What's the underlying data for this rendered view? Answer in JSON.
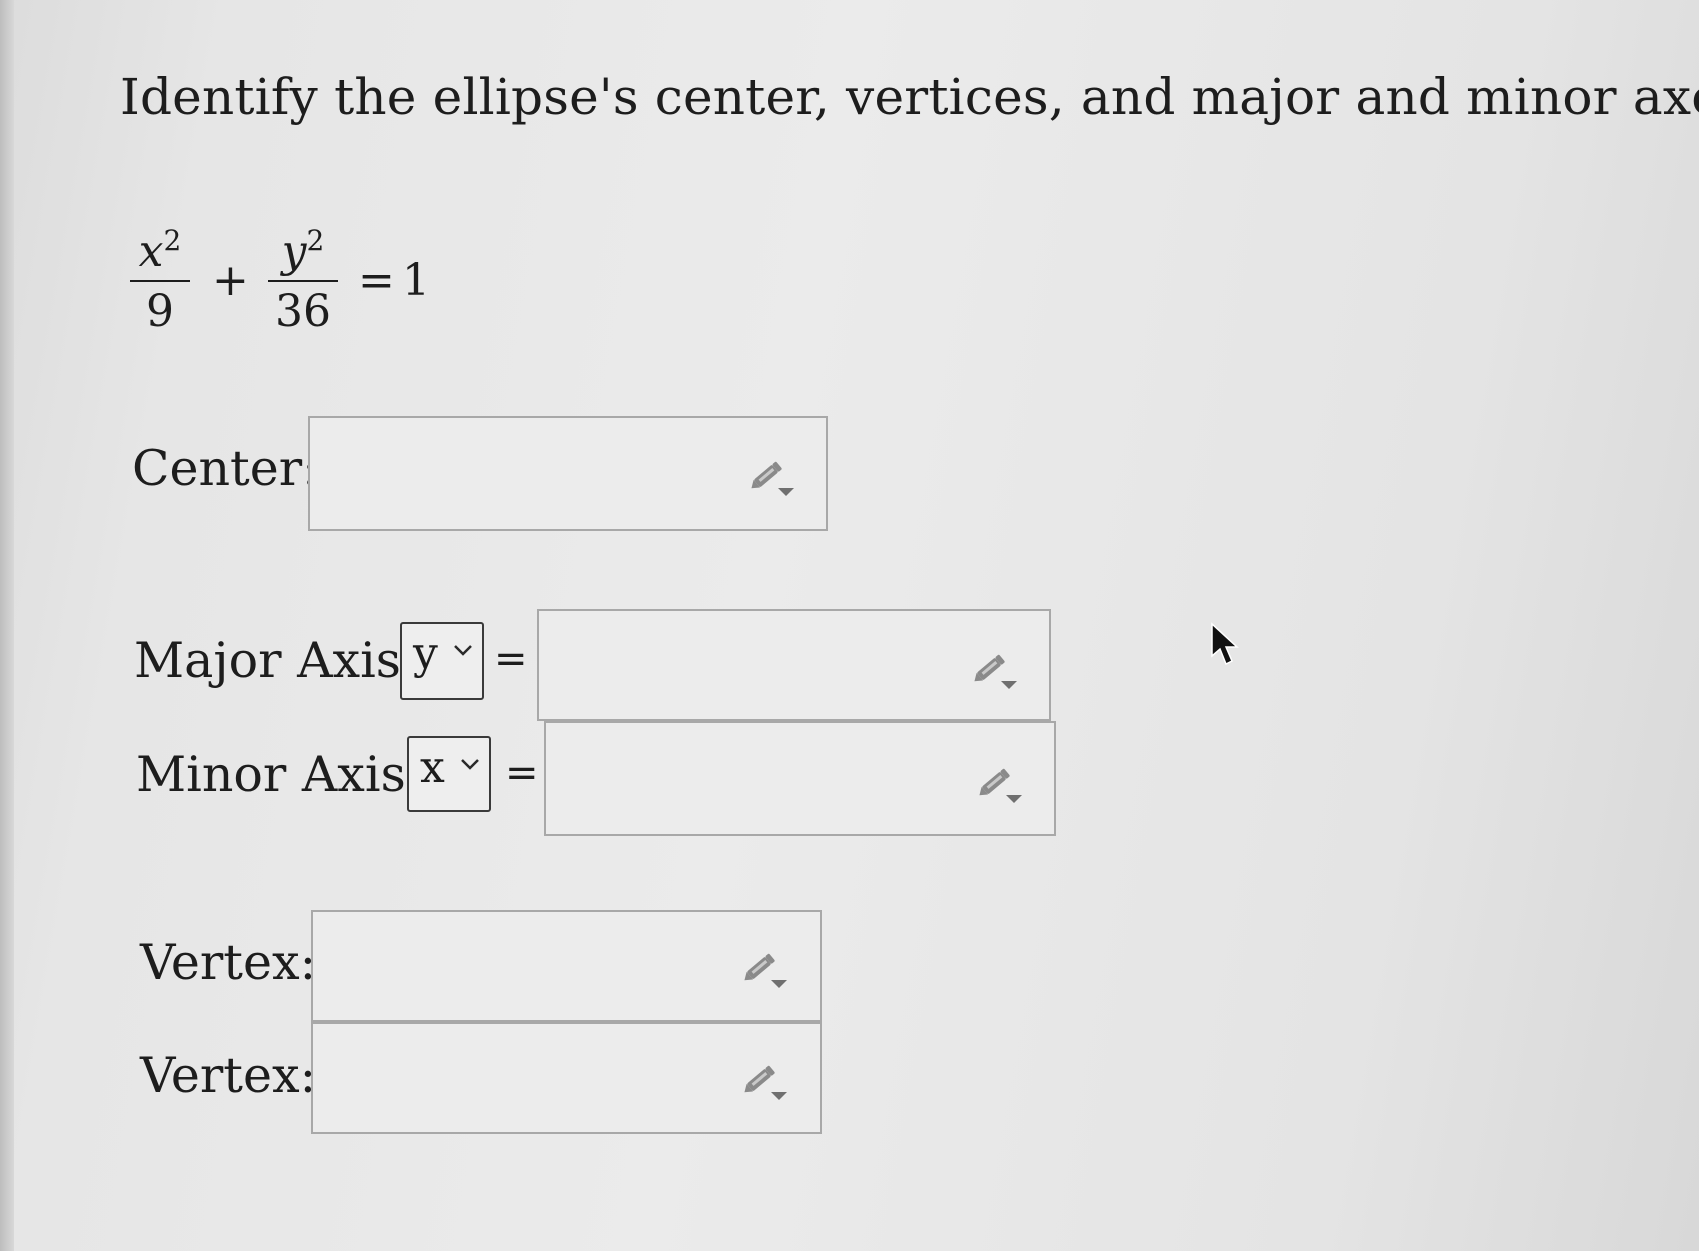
{
  "question": {
    "title": "Identify the ellipse's center, vertices, and major and minor axes."
  },
  "equation": {
    "term1_num_var": "x",
    "term1_num_exp": "2",
    "term1_den": "9",
    "plus": "+",
    "term2_num_var": "y",
    "term2_num_exp": "2",
    "term2_den": "36",
    "equals": "=",
    "rhs": "1"
  },
  "fields": {
    "center_label": "Center:",
    "center_value": "",
    "major_axis_label": "Major Axis:",
    "major_axis_select": "y",
    "major_axis_equals": "=",
    "major_axis_value": "",
    "minor_axis_label": "Minor Axis:",
    "minor_axis_select": "x",
    "minor_axis_equals": "=",
    "minor_axis_value": "",
    "vertex1_label": "Vertex:",
    "vertex1_value": "",
    "vertex2_label": "Vertex:",
    "vertex2_value": ""
  },
  "icons": {
    "answer_tool": "pencil-dropdown-icon",
    "select_arrow": "chevron-down-icon",
    "cursor": "mouse-pointer-icon"
  },
  "colors": {
    "text": "#1d1d1d",
    "box_border": "#a8a8a8",
    "icon_gray": "#8a8a8a"
  }
}
